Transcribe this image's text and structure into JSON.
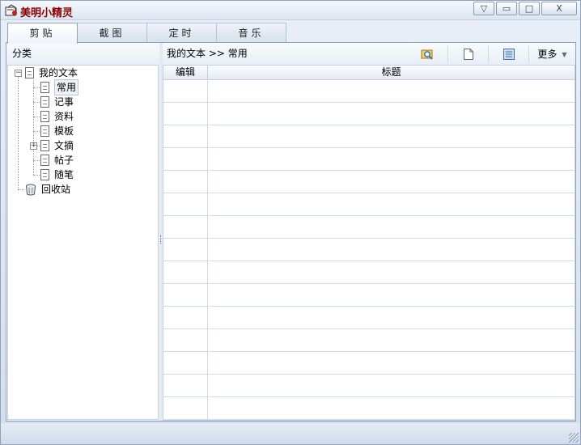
{
  "app": {
    "title": "美明小精灵"
  },
  "window_buttons": {
    "menu": "▽",
    "minimize": "▭",
    "maximize": "□",
    "close": "X"
  },
  "tabs": [
    {
      "label": "剪贴",
      "active": true
    },
    {
      "label": "截图",
      "active": false
    },
    {
      "label": "定时",
      "active": false
    },
    {
      "label": "音乐",
      "active": false
    }
  ],
  "category_panel": {
    "header": "分类",
    "tree": [
      {
        "label": "我的文本",
        "expander": "−",
        "icon": "document-icon"
      },
      {
        "label": "常用",
        "icon": "document-icon",
        "selected": true
      },
      {
        "label": "记事",
        "icon": "document-icon"
      },
      {
        "label": "资料",
        "icon": "document-icon"
      },
      {
        "label": "模板",
        "icon": "document-icon"
      },
      {
        "label": "文摘",
        "icon": "document-icon",
        "expander": "+"
      },
      {
        "label": "帖子",
        "icon": "document-icon"
      },
      {
        "label": "随笔",
        "icon": "document-icon"
      },
      {
        "label": "回收站",
        "icon": "recycle-bin-icon"
      }
    ]
  },
  "content_panel": {
    "breadcrumb": "我的文本 >> 常用",
    "toolbar": {
      "search_icon": "search-folder-icon",
      "new_icon": "new-document-icon",
      "view_icon": "view-list-icon",
      "more_label": "更多"
    },
    "table": {
      "columns": [
        "编辑",
        "标题"
      ],
      "rows": [
        [
          "",
          ""
        ],
        [
          "",
          ""
        ],
        [
          "",
          ""
        ],
        [
          "",
          ""
        ],
        [
          "",
          ""
        ],
        [
          "",
          ""
        ],
        [
          "",
          ""
        ],
        [
          "",
          ""
        ],
        [
          "",
          ""
        ],
        [
          "",
          ""
        ],
        [
          "",
          ""
        ],
        [
          "",
          ""
        ],
        [
          "",
          ""
        ],
        [
          "",
          ""
        ],
        [
          "",
          ""
        ]
      ]
    }
  },
  "colors": {
    "title_text": "#8b0000",
    "border": "#8ea3bf",
    "background": "#eef3f9"
  }
}
